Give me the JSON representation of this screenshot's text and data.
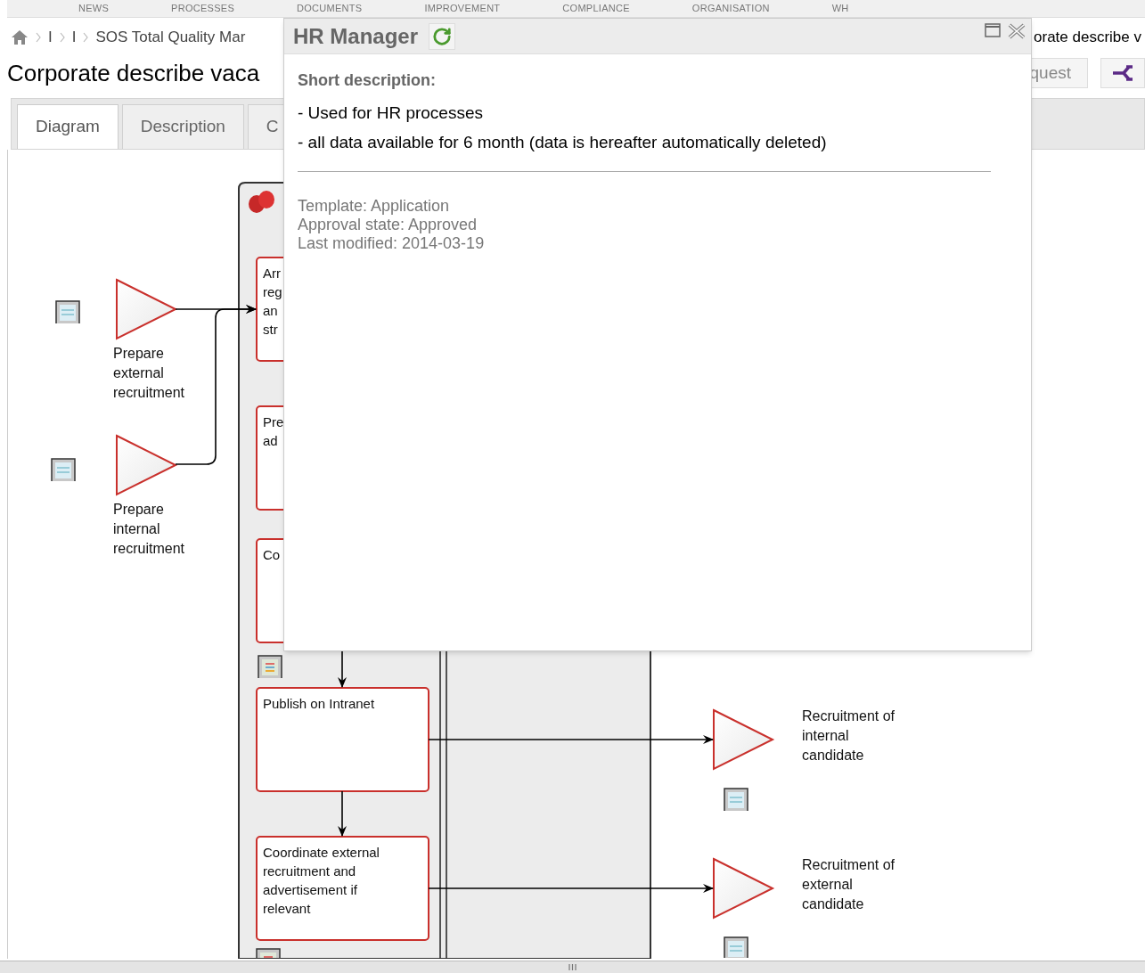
{
  "nav": [
    "NEWS",
    "PROCESSES",
    "DOCUMENTS",
    "IMPROVEMENT",
    "COMPLIANCE",
    "ORGANISATION",
    "WH"
  ],
  "breadcrumb": [
    "I",
    "I",
    "SOS Total Quality Mar"
  ],
  "breadcrumb_right": "orate describe v",
  "page_title": "Corporate describe vaca",
  "actions": {
    "request_label": "quest"
  },
  "tabs": [
    {
      "label": "Diagram",
      "selected": true
    },
    {
      "label": "Description",
      "selected": false
    },
    {
      "label": "C",
      "selected": false
    }
  ],
  "diagram": {
    "events": [
      {
        "lines": [
          "Prepare",
          "external",
          "recruitment"
        ]
      },
      {
        "lines": [
          "Prepare",
          "internal",
          "recruitment"
        ]
      },
      {
        "lines": [
          "Recruitment of",
          "internal",
          "candidate"
        ]
      },
      {
        "lines": [
          "Recruitment of",
          "external",
          "candidate"
        ]
      }
    ],
    "tasks": [
      {
        "lines": [
          "Arr",
          "reg",
          "an",
          "str"
        ]
      },
      {
        "lines": [
          "Pre",
          "ad"
        ]
      },
      {
        "lines": [
          "Co"
        ]
      },
      {
        "lines": [
          "Publish on Intranet"
        ]
      },
      {
        "lines": [
          "Coordinate external",
          "recruitment and",
          "advertisement if",
          "relevant"
        ]
      }
    ]
  },
  "dialog": {
    "title": "HR Manager",
    "short_description_label": "Short description:",
    "description_lines": [
      "- Used for HR processes",
      "- all data available for 6 month (data is hereafter automatically deleted)"
    ],
    "meta": [
      "Template: Application",
      "Approval state: Approved",
      "Last modified: 2014-03-19"
    ]
  }
}
